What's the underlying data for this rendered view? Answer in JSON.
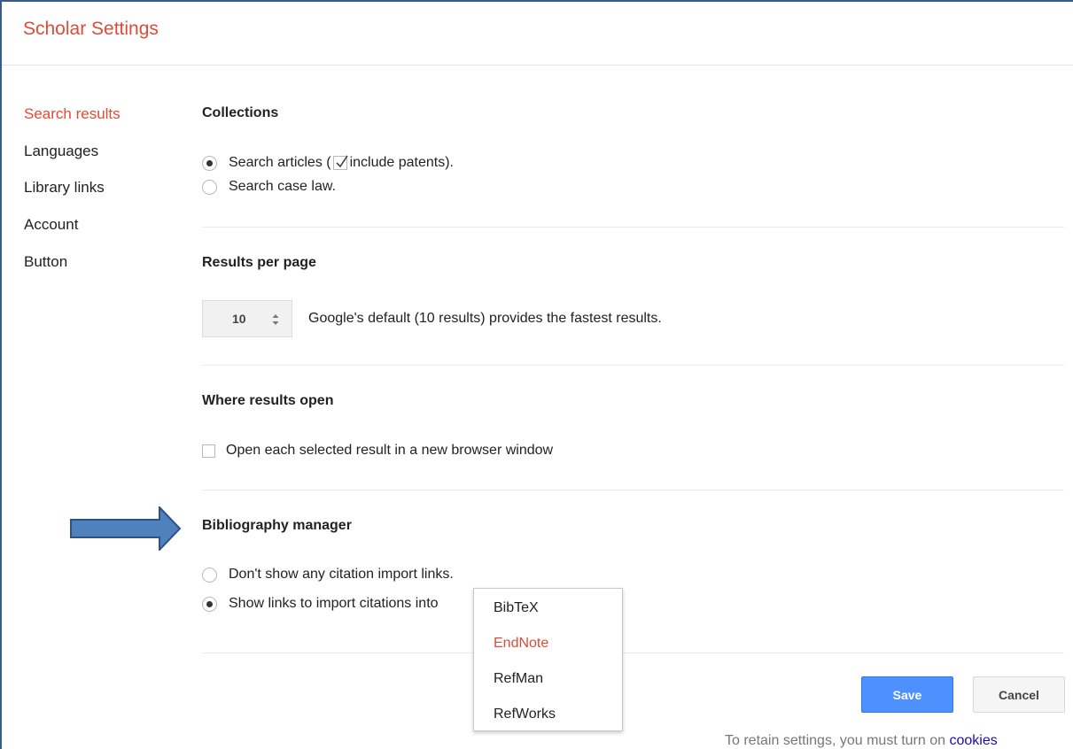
{
  "header": {
    "title": "Scholar Settings"
  },
  "nav": {
    "items": [
      {
        "label": "Search results",
        "active": true
      },
      {
        "label": "Languages",
        "active": false
      },
      {
        "label": "Library links",
        "active": false
      },
      {
        "label": "Account",
        "active": false
      },
      {
        "label": "Button",
        "active": false
      }
    ]
  },
  "collections": {
    "title": "Collections",
    "articles_prefix": "Search articles (",
    "include_patents": "include patents).",
    "include_patents_checked": true,
    "case_law": "Search case law.",
    "selected": "articles"
  },
  "results_per_page": {
    "title": "Results per page",
    "value": "10",
    "note": "Google's default (10 results) provides the fastest results."
  },
  "where_results_open": {
    "title": "Where results open",
    "new_window": "Open each selected result in a new browser window",
    "checked": false
  },
  "bibliography": {
    "title": "Bibliography manager",
    "no_links": "Don't show any citation import links.",
    "show_links": "Show links to import citations into",
    "selected": "show_links",
    "options": [
      "BibTeX",
      "EndNote",
      "RefMan",
      "RefWorks"
    ],
    "highlighted": "EndNote"
  },
  "buttons": {
    "save": "Save",
    "cancel": "Cancel"
  },
  "footer": {
    "text": "To retain settings, you must turn on",
    "link": "cookies"
  },
  "colors": {
    "accent_red": "#dd4b39",
    "save_blue": "#4d90fe",
    "arrow_blue": "#4f81bd",
    "link_blue": "#1a0dab"
  },
  "icons": {
    "arrow": "right-arrow-icon",
    "check": "check-icon",
    "stepper": "up-down-arrows-icon"
  }
}
